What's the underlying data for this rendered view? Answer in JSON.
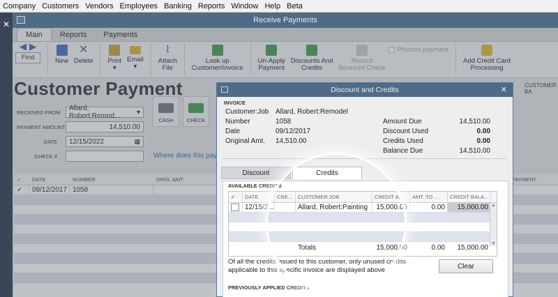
{
  "menubar": {
    "items": [
      "Company",
      "Customers",
      "Vendors",
      "Employees",
      "Banking",
      "Reports",
      "Window",
      "Help",
      "Beta"
    ]
  },
  "window": {
    "title": "Receive Payments"
  },
  "tabs": [
    "Main",
    "Reports",
    "Payments"
  ],
  "toolbar": {
    "find": "Find",
    "new": "New",
    "delete": "Delete",
    "print": "Print",
    "email": "Email",
    "attach": "Attach\nFile",
    "lookup": "Look up\nCustomer/Invoice",
    "unapply": "Un-Apply\nPayment",
    "discounts": "Discounts And\nCredits",
    "record": "Record\nBounced Check",
    "process_payment": "Process payment",
    "addcard": "Add Credit Card\nProcessing"
  },
  "form": {
    "title": "Customer Payment",
    "customer_balance_label": "CUSTOMER BA",
    "received_from_label": "RECEIVED FROM",
    "received_from": "Allard, Robert:Remod...",
    "payment_amount_label": "PAYMENT AMOUNT",
    "payment_amount": "14,510.00",
    "date_label": "DATE",
    "date": "12/15/2022",
    "check_label": "CHECK #",
    "check_value": "",
    "cash_label": "CASH",
    "check_btn_label": "CHECK",
    "where_link": "Where does this paym"
  },
  "main_grid": {
    "headers": {
      "check": "✓",
      "date": "DATE",
      "number": "NUMBER",
      "orig_amt": "ORIG. AMT.",
      "payment": "PAYMENT"
    },
    "rows": [
      {
        "check": "✓",
        "date": "09/12/2017",
        "number": "1058"
      }
    ]
  },
  "dialog": {
    "title": "Discount and Credits",
    "invoice_header": "INVOICE",
    "customer_job_label": "Customer:Job",
    "customer_job": "Allard, Robert:Remodel",
    "number_label": "Number",
    "number": "1058",
    "date_label": "Date",
    "date": "09/12/2017",
    "orig_amt_label": "Original Amt.",
    "orig_amt": "14,510.00",
    "amount_due_label": "Amount Due",
    "amount_due": "14,510.00",
    "discount_used_label": "Discount Used",
    "discount_used": "0.00",
    "credits_used_label": "Credits Used",
    "credits_used": "0.00",
    "balance_due_label": "Balance Due",
    "balance_due": "14,510.00",
    "tab_discount": "Discount",
    "tab_credits": "Credits",
    "available_credits_header": "AVAILABLE CREDITS",
    "credits_headers": {
      "check": "✓",
      "date": "DATE",
      "cre": "CRE...",
      "customer_job": "CUSTOMER:JOB",
      "credit_amt": "CREDIT A...",
      "amt_to": "AMT. TO ...",
      "credit_bal": "CREDIT BALA..."
    },
    "credits_rows": [
      {
        "date": "12/15/2...",
        "cre": "",
        "customer_job": "Allard, Robert:Painting",
        "credit_amt": "15,000.00",
        "amt_to": "0.00",
        "credit_bal": "15,000.00"
      }
    ],
    "totals_label": "Totals",
    "totals_credit_amt": "15,000.00",
    "totals_amt_to": "0.00",
    "totals_credit_bal": "15,000.00",
    "note": "Of all the credits issued to this customer, only unused credits applicable to this specific invoice are displayed above.",
    "clear_button": "Clear",
    "previously_applied_header": "PREVIOUSLY APPLIED CREDITS"
  },
  "colors": {
    "titlebar": "#4e6b87",
    "link": "#2e64b3",
    "row_alt": "#dde3ec"
  }
}
